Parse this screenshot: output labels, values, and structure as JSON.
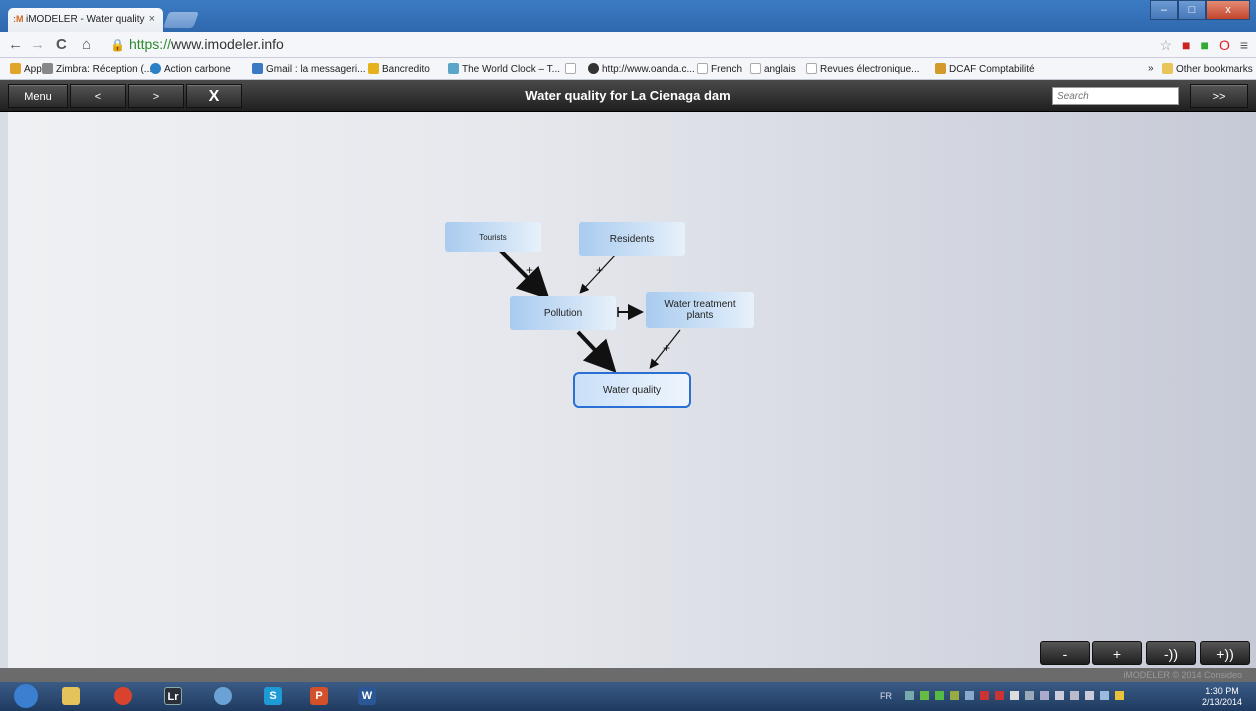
{
  "browser": {
    "tab_title": "iMODELER - Water quality",
    "tab_favicon": ":M",
    "tab_close": "×",
    "url_protocol": "https://",
    "url_rest": "www.imodeler.info",
    "window_controls": [
      "–",
      "□",
      "x"
    ],
    "nav": {
      "back": "←",
      "forward": "→",
      "reload": "C",
      "home": "⌂"
    },
    "bookmarks": [
      {
        "label": "Apps",
        "color": "#e0a52a"
      },
      {
        "label": "Zimbra: Réception (...",
        "color": "#888888"
      },
      {
        "label": "Action carbone",
        "color": "#2b7fc4"
      },
      {
        "label": "Gmail : la messageri...",
        "color": "#3b79c4"
      },
      {
        "label": "Bancredito",
        "color": "#e6b21a"
      },
      {
        "label": "The World Clock – T...",
        "color": "#5aa6c8"
      },
      {
        "label": "",
        "color": "#cccccc"
      },
      {
        "label": "http://www.oanda.c...",
        "color": "#333333"
      },
      {
        "label": "French",
        "color": "#cccccc"
      },
      {
        "label": "anglais",
        "color": "#cccccc"
      },
      {
        "label": "Revues électronique...",
        "color": "#cccccc"
      },
      {
        "label": "DCAF Comptabilité",
        "color": "#d39a2a"
      }
    ],
    "bookmarks_overflow": "»",
    "other_bookmarks": "Other bookmarks"
  },
  "app": {
    "menu_label": "Menu",
    "prev_label": "<",
    "next_label": ">",
    "fullscreen_label": "X",
    "title": "Water quality for La Cienaga dam",
    "search_placeholder": "Search",
    "go_label": ">>"
  },
  "diagram": {
    "nodes": {
      "tourists": "Tourists",
      "residents": "Residents",
      "pollution": "Pollution",
      "water_treatment": "Water treatment plants",
      "water_quality": "Water quality"
    },
    "edge_signs": {
      "tourists_pollution": "+",
      "residents_pollution": "+",
      "pollution_quality": "–",
      "treatment_quality": "+"
    }
  },
  "zoom": {
    "zoom_out": "-",
    "zoom_in": "+",
    "collapse": "-))",
    "expand": "+))"
  },
  "footer": {
    "copyright": "iMODELER © 2014 Consideo"
  },
  "taskbar": {
    "apps": [
      {
        "name": "start",
        "glyph": "",
        "color": "#3a7fd0"
      },
      {
        "name": "explorer",
        "glyph": "",
        "color": "#e4c35a"
      },
      {
        "name": "chrome",
        "glyph": "",
        "color": "#d9432e"
      },
      {
        "name": "lightroom",
        "glyph": "Lr",
        "color": "#2a2f3a"
      },
      {
        "name": "app5",
        "glyph": "",
        "color": "#6aa2d6"
      },
      {
        "name": "skype",
        "glyph": "S",
        "color": "#1e9bd7"
      },
      {
        "name": "powerpoint",
        "glyph": "P",
        "color": "#d2502a"
      },
      {
        "name": "word",
        "glyph": "W",
        "color": "#2b5797"
      }
    ],
    "language": "FR",
    "time": "1:30 PM",
    "date": "2/13/2014"
  }
}
